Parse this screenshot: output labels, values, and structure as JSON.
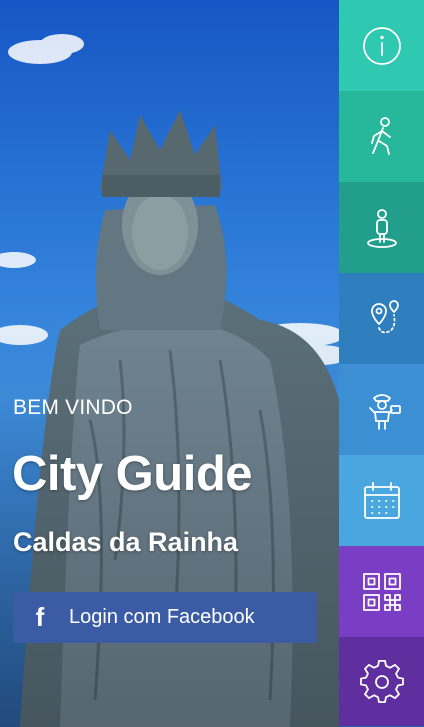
{
  "hero": {
    "welcome": "BEM VINDO",
    "title": "City Guide",
    "city": "Caldas da Rainha"
  },
  "login": {
    "facebook_glyph": "f",
    "facebook_label": "Login com Facebook"
  },
  "side_menu": [
    {
      "icon": "info-icon",
      "color": "#2ec9b0"
    },
    {
      "icon": "walking-person-icon",
      "color": "#27b79a"
    },
    {
      "icon": "person-location-icon",
      "color": "#219f8c"
    },
    {
      "icon": "route-pins-icon",
      "color": "#2f7fbe"
    },
    {
      "icon": "tourist-camera-icon",
      "color": "#3b8fd2"
    },
    {
      "icon": "calendar-icon",
      "color": "#4aa6df"
    },
    {
      "icon": "qr-code-icon",
      "color": "#7a3ec4"
    },
    {
      "icon": "gear-icon",
      "color": "#5f2f9f"
    }
  ],
  "colors": {
    "facebook": "#3b5ba5",
    "text": "#ffffff"
  }
}
